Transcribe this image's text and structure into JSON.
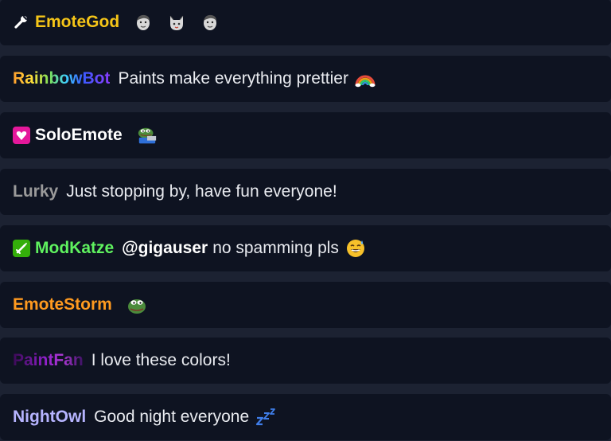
{
  "messages": [
    {
      "username": "EmoteGod",
      "color": "#f5c518",
      "badge": "wrench-icon",
      "text": "",
      "emotes": [
        "face-emote-1",
        "cat-face-emote",
        "face-emote-2"
      ]
    },
    {
      "username": "RainbowBot",
      "color": "rainbow-gradient",
      "badge": "",
      "text": "Paints make everything prettier",
      "emotes": [
        "rainbow-emoji"
      ]
    },
    {
      "username": "SoloEmote",
      "color": "#ffffff",
      "badge": "heart-gem-icon",
      "text": "",
      "emotes": [
        "pepe-laptop-emote"
      ]
    },
    {
      "username": "Lurky",
      "color": "#9a9a9a",
      "badge": "",
      "text": "Just stopping by, have fun everyone!",
      "emotes": []
    },
    {
      "username": "ModKatze",
      "color": "#5ff25f",
      "badge": "sword-icon",
      "mention": "@gigauser",
      "text": "no spamming pls",
      "emotes": [
        "sweat-smile-emoji"
      ]
    },
    {
      "username": "EmoteStorm",
      "color": "#ff9a1f",
      "badge": "",
      "text": "",
      "emotes": [
        "pepe-emote"
      ]
    },
    {
      "username": "PaintFan",
      "color": "purple-gradient",
      "badge": "",
      "text": "I love these colors!",
      "emotes": []
    },
    {
      "username": "NightOwl",
      "color": "#b6b4ff",
      "badge": "",
      "text": "Good night everyone",
      "emotes": [
        "zzz-emoji"
      ]
    }
  ]
}
